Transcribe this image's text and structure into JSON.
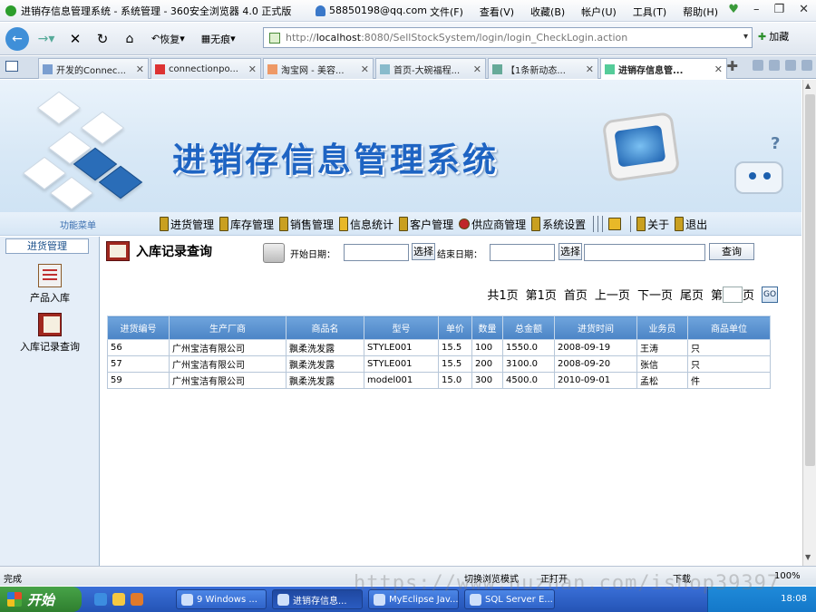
{
  "window": {
    "title": "进销存信息管理系统 - 系统管理 - 360安全浏览器 4.0 正式版",
    "user": "58850198@qq.com",
    "menu": [
      "文件(F)",
      "查看(V)",
      "收藏(B)",
      "帐户(U)",
      "工具(T)",
      "帮助(H)"
    ]
  },
  "navbar": {
    "restore_label": "恢复",
    "noimg_label": "无痕",
    "address_scheme": "http://",
    "address_host": "localhost",
    "address_rest": ":8080/SellStockSystem/login/login_CheckLogin.action",
    "fav_label": "加藏"
  },
  "tabs": [
    {
      "label": "开发的Connec..."
    },
    {
      "label": "connectionpo..."
    },
    {
      "label": "淘宝网 - 美容..."
    },
    {
      "label": "首页-大碗福程..."
    },
    {
      "label": "【1条新动态..."
    },
    {
      "label": "进销存信息管..."
    }
  ],
  "banner": {
    "title": "进销存信息管理系统"
  },
  "toolbar": {
    "side_label": "功能菜单",
    "items": [
      "进货管理",
      "库存管理",
      "销售管理",
      "信息统计",
      "客户管理",
      "供应商管理",
      "系统设置",
      "关于",
      "退出"
    ]
  },
  "sidebar": {
    "header": "进货管理",
    "items": [
      {
        "label": "产品入库",
        "icon": "document-icon"
      },
      {
        "label": "入库记录查询",
        "icon": "book-icon"
      }
    ]
  },
  "main": {
    "title": "入库记录查询",
    "start_date_label": "开始日期：",
    "end_date_label": "结束日期：",
    "choose_label": "选择",
    "query_label": "查询",
    "pager": {
      "total": "共1页",
      "current": "第1页",
      "first": "首页",
      "prev": "上一页",
      "next": "下一页",
      "last": "尾页",
      "goto_prefix": "第",
      "goto_suffix": "页",
      "go": "GO"
    },
    "table": {
      "headers": [
        "进货编号",
        "生产厂商",
        "商品名",
        "型号",
        "单价",
        "数量",
        "总金额",
        "进货时间",
        "业务员",
        "商品单位"
      ],
      "rows": [
        [
          "56",
          "广州宝洁有限公司",
          "飘柔洗发露",
          "STYLE001",
          "15.5",
          "100",
          "1550.0",
          "2008-09-19",
          "王涛",
          "只"
        ],
        [
          "57",
          "广州宝洁有限公司",
          "飘柔洗发露",
          "STYLE001",
          "15.5",
          "200",
          "3100.0",
          "2008-09-20",
          "张信",
          "只"
        ],
        [
          "59",
          "广州宝洁有限公司",
          "飘柔洗发露",
          "model001",
          "15.0",
          "300",
          "4500.0",
          "2010-09-01",
          "孟松",
          "件"
        ]
      ]
    }
  },
  "status": {
    "done": "完成",
    "switch_mode": "切换浏览模式",
    "open_label": "正打开",
    "download": "下载",
    "zoom": "100%"
  },
  "taskbar": {
    "start": "开始",
    "tasks": [
      "9 Windows ...",
      "进销存信息...",
      "MyEclipse Jav...",
      "SQL Server E..."
    ],
    "time": "18:08"
  },
  "watermark": "https://www.huzhan.com/ishop39397",
  "colors": {
    "banner_title": "#1e64c3",
    "table_header": "#4b84c6",
    "taskbar": "#2454b5"
  }
}
